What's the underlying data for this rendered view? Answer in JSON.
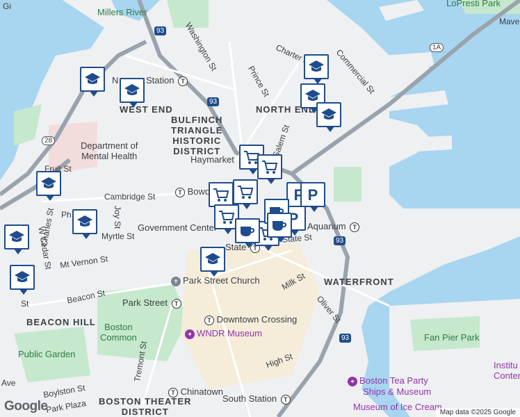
{
  "districts": {
    "west_end": "WEST END",
    "north_end": "NORTH END",
    "bulfinch": [
      "BULFINCH",
      "TRIANGLE",
      "HISTORIC",
      "DISTRICT"
    ],
    "waterfront": "WATERFRONT",
    "beacon_hill": "BEACON HILL",
    "boston_theater": [
      "BOSTON THEATER",
      "DISTRICT"
    ]
  },
  "streets": {
    "washington": "Washington St",
    "charter": "Charter St",
    "commercial": "Commercial St",
    "prince": "Prince St",
    "salem": "Salem St",
    "cambridge": "Cambridge St",
    "fruit": "Fruit St",
    "joy": "Joy St",
    "charles": "Charles St",
    "w_cedar": "W Cedar St",
    "myrtle": "Myrtle St",
    "mt_vernon": "Mt Vernon St",
    "beacon": "Beacon St",
    "state": "State St",
    "milk": "Milk St",
    "oliver": "Oliver St",
    "high": "High St",
    "tremont": "Tremont St",
    "boylston": "Boylston St",
    "park_plaza": "Park Plaza",
    "ph": "Ph",
    "ave": "Ave",
    "st": "St"
  },
  "places": {
    "millers_river": "Millers River",
    "lopresti_park": "LoPresti Park",
    "mave": "Mave",
    "dept_mental_health": [
      "Department of",
      "Mental Health"
    ],
    "haymarket": "Haymarket",
    "bowdoin": "Bowd",
    "government_center": "Government Center",
    "state_station": "State",
    "aquarium": "Aquarium",
    "park_street_church": "Park Street Church",
    "park_street": "Park Street",
    "downtown_crossing": "Downtown Crossing",
    "wndr": "WNDR Museum",
    "boston_common": [
      "Boston",
      "Common"
    ],
    "public_garden": "Public Garden",
    "chinatown": "Chinatown",
    "south_station": "South Station",
    "fan_pier": "Fan Pier Park",
    "tea_party": [
      "Boston Tea Party",
      "Ships & Museum"
    ],
    "ice_cream": "Museum of Ice Cream",
    "institute": [
      "Institu",
      "Conten"
    ],
    "gi": "Gi",
    "n_station": "N",
    "station_suffix": "Station"
  },
  "shields": {
    "i93_a": "93",
    "i93_b": "93",
    "i93_c": "93",
    "i93_d": "93",
    "r28": "28",
    "r1a": "1A"
  },
  "footer": {
    "attribution": "Map data ©2025 Google",
    "logo": "Google"
  },
  "colors": {
    "water": "#a8d5f0",
    "park": "#c6e8cc",
    "land": "#eef0f2",
    "pin_border": "#1e4c8c",
    "pin_icon": "#1e4c8c",
    "poi_purple": "#9334a8"
  },
  "markers": [
    {
      "type": "school",
      "icon": "school-icon"
    },
    {
      "type": "school",
      "icon": "school-icon"
    },
    {
      "type": "school",
      "icon": "school-icon"
    },
    {
      "type": "school",
      "icon": "school-icon"
    },
    {
      "type": "school",
      "icon": "school-icon"
    },
    {
      "type": "school",
      "icon": "school-icon"
    },
    {
      "type": "school",
      "icon": "school-icon"
    },
    {
      "type": "school",
      "icon": "school-icon"
    },
    {
      "type": "school",
      "icon": "school-icon"
    },
    {
      "type": "school",
      "icon": "school-icon"
    },
    {
      "type": "grocery",
      "icon": "shopping-cart-icon"
    },
    {
      "type": "grocery",
      "icon": "shopping-cart-icon"
    },
    {
      "type": "grocery",
      "icon": "shopping-cart-icon"
    },
    {
      "type": "grocery",
      "icon": "shopping-cart-icon"
    },
    {
      "type": "grocery",
      "icon": "shopping-cart-icon"
    },
    {
      "type": "grocery",
      "icon": "shopping-cart-icon"
    },
    {
      "type": "parking",
      "icon": "parking-icon"
    },
    {
      "type": "parking",
      "icon": "parking-icon"
    },
    {
      "type": "parking",
      "icon": "parking-icon"
    },
    {
      "type": "cafe",
      "icon": "coffee-cup-icon"
    },
    {
      "type": "cafe",
      "icon": "coffee-cup-icon"
    },
    {
      "type": "cafe",
      "icon": "coffee-cup-icon"
    }
  ]
}
